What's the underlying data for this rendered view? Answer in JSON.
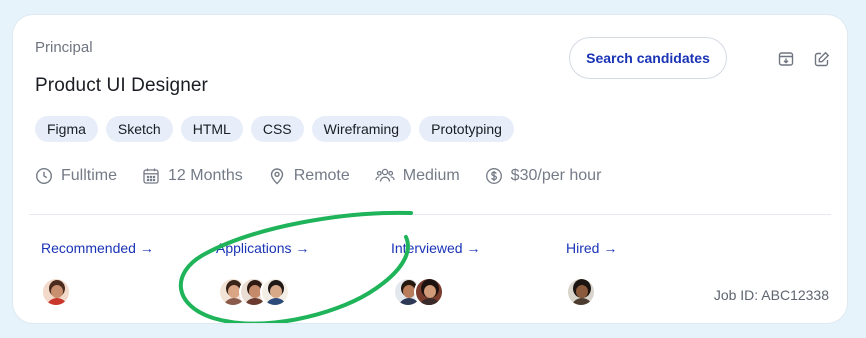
{
  "job": {
    "level": "Principal",
    "title": "Product UI Designer",
    "search_button_label": "Search candidates",
    "tags": [
      "Figma",
      "Sketch",
      "HTML",
      "CSS",
      "Wireframing",
      "Prototyping"
    ],
    "meta": {
      "type": "Fulltime",
      "duration": "12 Months",
      "location": "Remote",
      "size": "Medium",
      "rate": "$30/per hour"
    },
    "job_id": "Job ID: ABC12338"
  },
  "stages": [
    {
      "label": "Recommended →",
      "avatar_count": 1
    },
    {
      "label": "Applications →",
      "avatar_count": 3
    },
    {
      "label": "Interviewed →",
      "avatar_count": 2
    },
    {
      "label": "Hired →",
      "avatar_count": 1
    }
  ],
  "colors": {
    "accent": "#1a34b5",
    "tag_bg": "#e7edf9",
    "annotation": "#1fb35a",
    "background": "#e6f3fb"
  },
  "icons": {
    "archive": "archive-icon",
    "edit": "edit-icon",
    "clock": "clock-icon",
    "calendar": "calendar-icon",
    "location": "location-pin-icon",
    "team": "team-icon",
    "dollar": "dollar-icon"
  }
}
